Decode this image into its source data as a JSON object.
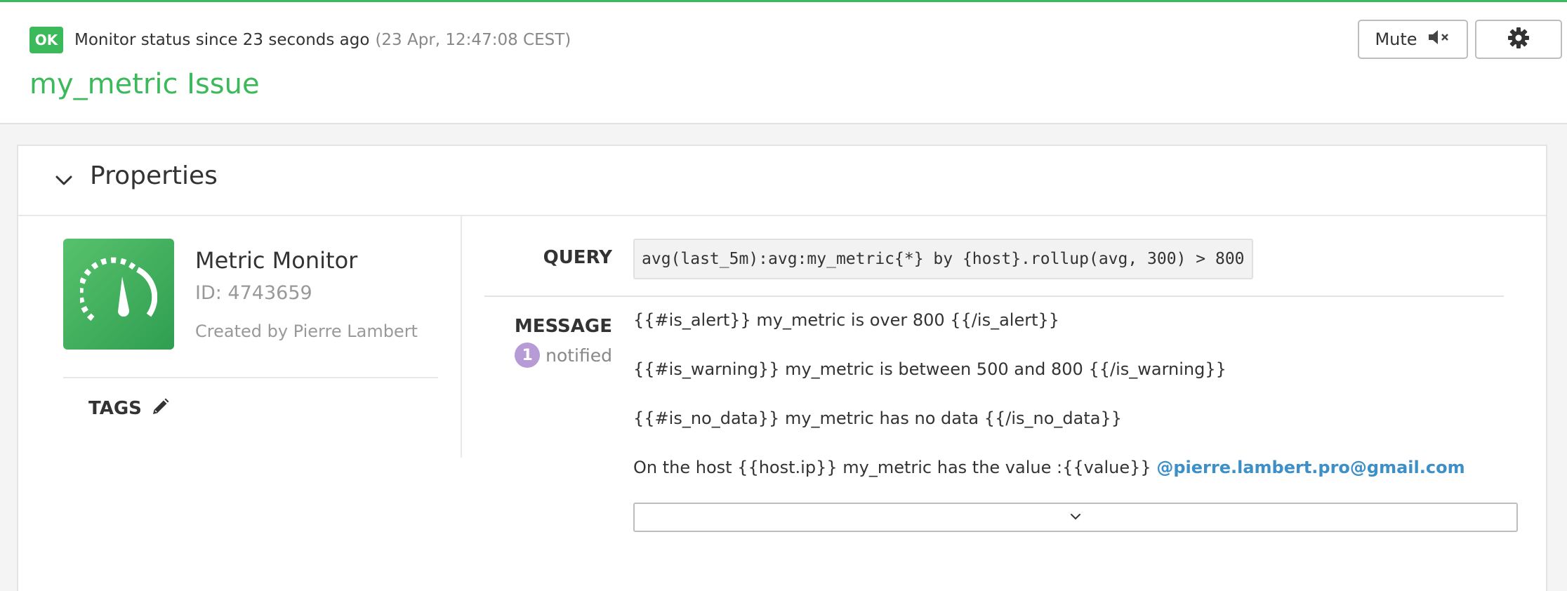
{
  "header": {
    "status_badge": "OK",
    "status_text": "Monitor status since 23 seconds ago",
    "status_time": "(23 Apr, 12:47:08 CEST)",
    "title": "my_metric Issue",
    "mute_label": "Mute",
    "mute_icon": "speaker-muted-icon",
    "settings_icon": "gear-icon"
  },
  "properties": {
    "section_title": "Properties",
    "monitor_type": "Metric Monitor",
    "monitor_id": "ID: 4743659",
    "created_by": "Created by Pierre Lambert",
    "tags_label": "TAGS",
    "query_label": "QUERY",
    "query": "avg(last_5m):avg:my_metric{*} by {host}.rollup(avg, 300) > 800",
    "message_label": "MESSAGE",
    "notified_count": "1",
    "notified_label": "notified",
    "message_lines": [
      "{{#is_alert}} my_metric is over 800 {{/is_alert}}",
      "{{#is_warning}} my_metric is between 500 and 800 {{/is_warning}}",
      "{{#is_no_data}} my_metric has no data {{/is_no_data}}",
      "On the host {{host.ip}} my_metric has the value :{{value}}"
    ],
    "mention": "@pierre.lambert.pro@gmail.com"
  },
  "colors": {
    "accent": "#3cb95a",
    "link": "#3d8fc7",
    "notified_badge": "#b69bd6"
  }
}
